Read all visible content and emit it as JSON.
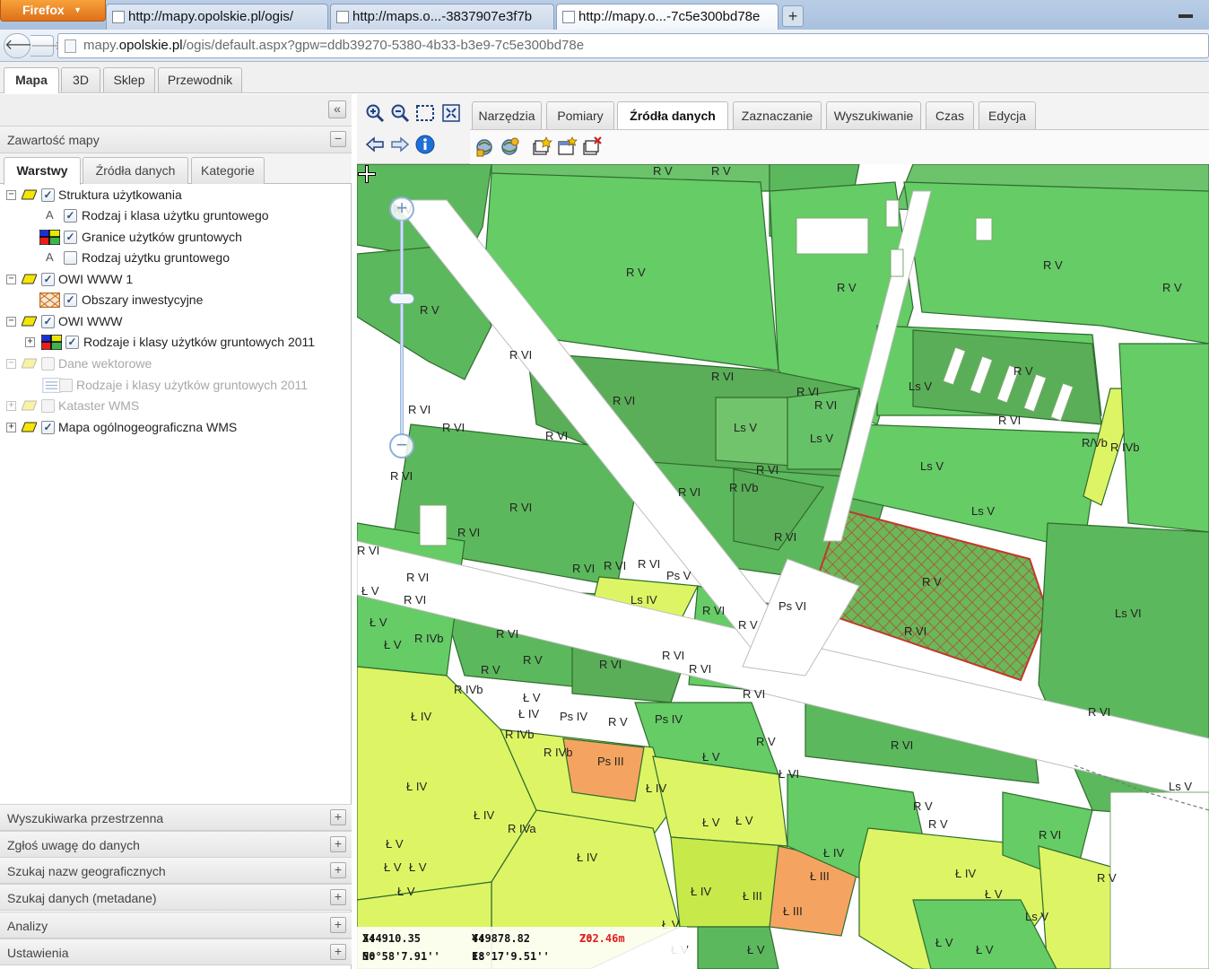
{
  "browser": {
    "firefox_button": "Firefox",
    "tabs": [
      {
        "title": "http://mapy.opolskie.pl/ogis/"
      },
      {
        "title": "http://maps.o...-3837907e3f7b"
      },
      {
        "title": "http://mapy.o...-7c5e300bd78e"
      }
    ],
    "new_tab": "+",
    "url_prefix": "mapy.",
    "url_domain": "opolskie.pl",
    "url_path": "/ogis/default.aspx?gpw=ddb39270-5380-4b33-b3e9-7c5e300bd78e"
  },
  "app_tabs": [
    "Mapa",
    "3D",
    "Sklep",
    "Przewodnik"
  ],
  "left_panel": {
    "content_title": "Zawartość mapy",
    "sub_tabs": [
      "Warstwy",
      "Źródła danych",
      "Kategorie"
    ],
    "layers": [
      {
        "label": "Struktura użytkowania",
        "checked": true
      },
      {
        "label": "Rodzaj i klasa użytku gruntowego",
        "checked": true
      },
      {
        "label": "Granice użytków gruntowych",
        "checked": true
      },
      {
        "label": "Rodzaj użytku gruntowego",
        "checked": false
      },
      {
        "label": "OWI WWW 1",
        "checked": true
      },
      {
        "label": "Obszary inwestycyjne",
        "checked": true
      },
      {
        "label": "OWI WWW",
        "checked": true
      },
      {
        "label": "Rodzaje i klasy użytków gruntowych 2011",
        "checked": true
      },
      {
        "label": "Dane wektorowe",
        "checked": false
      },
      {
        "label": "Rodzaje i klasy użytków gruntowych 2011",
        "checked": false
      },
      {
        "label": "Kataster WMS",
        "checked": false
      },
      {
        "label": "Mapa ogólnogeograficzna WMS",
        "checked": true
      }
    ],
    "accordion": [
      "Wyszukiwarka przestrzenna",
      "Zgłoś uwagę do danych",
      "Szukaj nazw geograficznych",
      "Szukaj danych (metadane)",
      "Analizy",
      "Ustawienia"
    ]
  },
  "map_tabs": [
    "Narzędzia",
    "Pomiary",
    "Źródła danych",
    "Zaznaczanie",
    "Wyszukiwanie",
    "Czas",
    "Edycja"
  ],
  "map_tabs_active": "Źródła danych",
  "coords": {
    "x_label": "X:",
    "x": "344910.35",
    "y_label": "Y:",
    "y": "449878.82",
    "z_label": "Z:",
    "z": "202.46m",
    "n_label": "N:",
    "n": "50°58'7.91''",
    "e_label": "E:",
    "e": "18°17'9.51''"
  },
  "map_labels": [
    "R V",
    "R V",
    "R V",
    "R V",
    "R V",
    "R V",
    "R V",
    "R V",
    "R VI",
    "R VI",
    "R VI",
    "R VI",
    "R VI",
    "R VI",
    "R VI",
    "R VI",
    "R VI",
    "R VI",
    "R VI",
    "R VI",
    "R VI",
    "R VI",
    "R VI",
    "R VI",
    "R VI",
    "R VI",
    "R VI",
    "R VI",
    "R VI",
    "R VI",
    "Ls V",
    "Ls V",
    "Ls V",
    "Ls V",
    "Ls V",
    "Ls VI",
    "Ls IV",
    "Ps V",
    "Ps VI",
    "Ps IV",
    "Ps III",
    "Ps IV",
    "R IVb",
    "R IVb",
    "R IVb",
    "R IVb",
    "R IVa",
    "Ł IV",
    "Ł IV",
    "Ł IV",
    "Ł IV",
    "Ł IV",
    "Ł IV",
    "Ł IV",
    "Ł IV",
    "Ł IV",
    "Ł V",
    "Ł V",
    "Ł V",
    "Ł V",
    "Ł V",
    "Ł V",
    "Ł V",
    "Ł VI",
    "Ł III",
    "Ł III",
    "Ł III",
    "Ls VI",
    "Ls V",
    "R/Vb",
    "R IVb"
  ],
  "colors": {
    "class_v": "#66cc66",
    "class_vi": "#5cb85c",
    "forest": "#71c46b",
    "meadow_iv": "#ddf564",
    "meadow_v": "#c7ea4a",
    "pasture_iii": "#f4a460",
    "investment_hatch": "#c0392b"
  }
}
